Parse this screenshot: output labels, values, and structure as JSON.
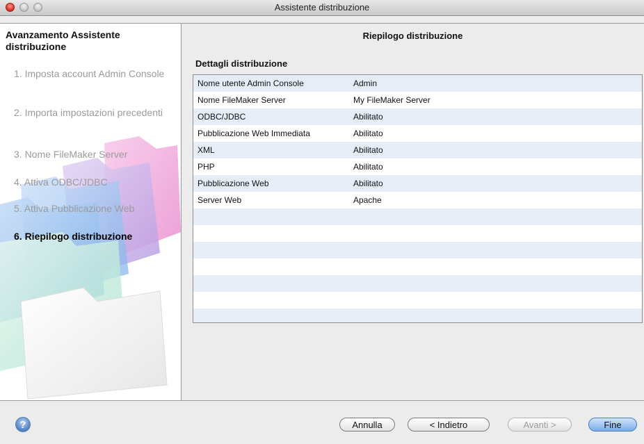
{
  "window": {
    "title": "Assistente distribuzione"
  },
  "left": {
    "title": "Avanzamento Assistente distribuzione",
    "steps": [
      {
        "label": "1. Imposta account Admin Console",
        "active": false
      },
      {
        "label": "2. Importa impostazioni precedenti",
        "active": false
      },
      {
        "label": "3. Nome FileMaker Server",
        "active": false
      },
      {
        "label": "4. Attiva ODBC/JDBC",
        "active": false
      },
      {
        "label": "5. Attiva Pubblicazione Web",
        "active": false
      },
      {
        "label": "6. Riepilogo distribuzione",
        "active": true
      }
    ]
  },
  "right": {
    "title": "Riepilogo distribuzione",
    "section_title": "Dettagli distribuzione",
    "rows": [
      {
        "name": "Nome utente Admin Console",
        "value": "Admin"
      },
      {
        "name": "Nome FileMaker Server",
        "value": "My FileMaker Server"
      },
      {
        "name": "ODBC/JDBC",
        "value": "Abilitato"
      },
      {
        "name": "Pubblicazione Web Immediata",
        "value": "Abilitato"
      },
      {
        "name": "XML",
        "value": "Abilitato"
      },
      {
        "name": "PHP",
        "value": "Abilitato"
      },
      {
        "name": "Pubblicazione Web",
        "value": "Abilitato"
      },
      {
        "name": "Server Web",
        "value": "Apache"
      },
      {
        "name": "",
        "value": ""
      },
      {
        "name": "",
        "value": ""
      },
      {
        "name": "",
        "value": ""
      },
      {
        "name": "",
        "value": ""
      },
      {
        "name": "",
        "value": ""
      },
      {
        "name": "",
        "value": ""
      },
      {
        "name": "",
        "value": ""
      }
    ]
  },
  "buttons": {
    "help": "?",
    "cancel": "Annulla",
    "back": "< Indietro",
    "next": "Avanti >",
    "finish": "Fine"
  },
  "icons": {
    "help": "help-icon"
  },
  "colors": {
    "row_alt": "#e7edf7",
    "default_button": "#79aee8"
  }
}
